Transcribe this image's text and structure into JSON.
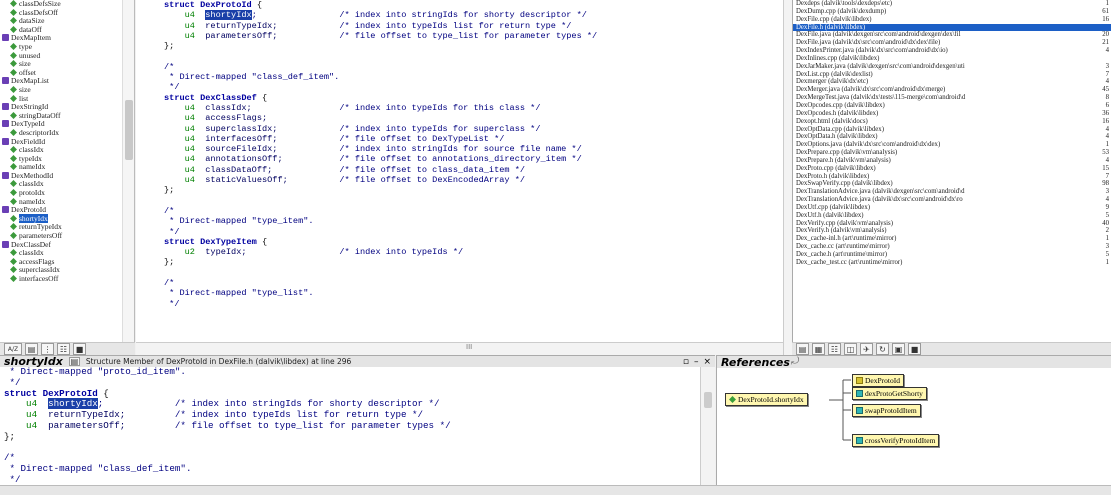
{
  "tree": {
    "items": [
      {
        "label": "classDefsSize",
        "kind": "field",
        "indent": 2
      },
      {
        "label": "classDefsOff",
        "kind": "field",
        "indent": 2
      },
      {
        "label": "dataSize",
        "kind": "field",
        "indent": 2
      },
      {
        "label": "dataOff",
        "kind": "field",
        "indent": 2
      },
      {
        "label": "DexMapItem",
        "kind": "struct",
        "indent": 1
      },
      {
        "label": "type",
        "kind": "field",
        "indent": 2
      },
      {
        "label": "unused",
        "kind": "field",
        "indent": 2
      },
      {
        "label": "size",
        "kind": "field",
        "indent": 2
      },
      {
        "label": "offset",
        "kind": "field",
        "indent": 2
      },
      {
        "label": "DexMapList",
        "kind": "struct",
        "indent": 1
      },
      {
        "label": "size",
        "kind": "field",
        "indent": 2
      },
      {
        "label": "list",
        "kind": "field",
        "indent": 2
      },
      {
        "label": "DexStringId",
        "kind": "struct",
        "indent": 1
      },
      {
        "label": "stringDataOff",
        "kind": "field",
        "indent": 2
      },
      {
        "label": "DexTypeId",
        "kind": "struct",
        "indent": 1
      },
      {
        "label": "descriptorIdx",
        "kind": "field",
        "indent": 2
      },
      {
        "label": "DexFieldId",
        "kind": "struct",
        "indent": 1
      },
      {
        "label": "classIdx",
        "kind": "field",
        "indent": 2
      },
      {
        "label": "typeIdx",
        "kind": "field",
        "indent": 2
      },
      {
        "label": "nameIdx",
        "kind": "field",
        "indent": 2
      },
      {
        "label": "DexMethodId",
        "kind": "struct",
        "indent": 1
      },
      {
        "label": "classIdx",
        "kind": "field",
        "indent": 2
      },
      {
        "label": "protoIdx",
        "kind": "field",
        "indent": 2
      },
      {
        "label": "nameIdx",
        "kind": "field",
        "indent": 2
      },
      {
        "label": "DexProtoId",
        "kind": "struct",
        "indent": 1
      },
      {
        "label": "shortyIdx",
        "kind": "field",
        "indent": 2,
        "selected": true
      },
      {
        "label": "returnTypeIdx",
        "kind": "field",
        "indent": 2
      },
      {
        "label": "parametersOff",
        "kind": "field",
        "indent": 2
      },
      {
        "label": "DexClassDef",
        "kind": "struct",
        "indent": 1
      },
      {
        "label": "classIdx",
        "kind": "field",
        "indent": 2
      },
      {
        "label": "accessFlags",
        "kind": "field",
        "indent": 2
      },
      {
        "label": "superclassIdx",
        "kind": "field",
        "indent": 2
      },
      {
        "label": "interfacesOff",
        "kind": "field",
        "indent": 2
      }
    ],
    "toolbar_sort_label": "A/Z"
  },
  "editor": {
    "lines": [
      [
        {
          "t": "struct ",
          "c": "kw"
        },
        {
          "t": "DexProtoId",
          "c": "kw"
        },
        {
          "t": " {"
        }
      ],
      [
        {
          "t": "    u4  ",
          "c": "ty"
        },
        {
          "t": "shortyIdx",
          "c": "hl"
        },
        {
          "t": ";                /* index into stringIds for shorty descriptor */",
          "c": "cm"
        }
      ],
      [
        {
          "t": "    u4  ",
          "c": "ty"
        },
        {
          "t": "returnTypeIdx;            ",
          "c": "id"
        },
        {
          "t": "/* index into typeIds list for return type */",
          "c": "cm"
        }
      ],
      [
        {
          "t": "    u4  ",
          "c": "ty"
        },
        {
          "t": "parametersOff;            ",
          "c": "id"
        },
        {
          "t": "/* file offset to type_list for parameter types */",
          "c": "cm"
        }
      ],
      [
        {
          "t": "};"
        }
      ],
      [
        {
          "t": ""
        }
      ],
      [
        {
          "t": "/*",
          "c": "cm"
        }
      ],
      [
        {
          "t": " * Direct-mapped \"class_def_item\".",
          "c": "cm"
        }
      ],
      [
        {
          "t": " */",
          "c": "cm"
        }
      ],
      [
        {
          "t": "struct ",
          "c": "kw"
        },
        {
          "t": "DexClassDef",
          "c": "kw"
        },
        {
          "t": " {"
        }
      ],
      [
        {
          "t": "    u4  ",
          "c": "ty"
        },
        {
          "t": "classIdx;                 ",
          "c": "id"
        },
        {
          "t": "/* index into typeIds for this class */",
          "c": "cm"
        }
      ],
      [
        {
          "t": "    u4  ",
          "c": "ty"
        },
        {
          "t": "accessFlags;",
          "c": "id"
        }
      ],
      [
        {
          "t": "    u4  ",
          "c": "ty"
        },
        {
          "t": "superclassIdx;            ",
          "c": "id"
        },
        {
          "t": "/* index into typeIds for superclass */",
          "c": "cm"
        }
      ],
      [
        {
          "t": "    u4  ",
          "c": "ty"
        },
        {
          "t": "interfacesOff;            ",
          "c": "id"
        },
        {
          "t": "/* file offset to DexTypeList */",
          "c": "cm"
        }
      ],
      [
        {
          "t": "    u4  ",
          "c": "ty"
        },
        {
          "t": "sourceFileIdx;            ",
          "c": "id"
        },
        {
          "t": "/* index into stringIds for source file name */",
          "c": "cm"
        }
      ],
      [
        {
          "t": "    u4  ",
          "c": "ty"
        },
        {
          "t": "annotationsOff;           ",
          "c": "id"
        },
        {
          "t": "/* file offset to annotations_directory_item */",
          "c": "cm"
        }
      ],
      [
        {
          "t": "    u4  ",
          "c": "ty"
        },
        {
          "t": "classDataOff;             ",
          "c": "id"
        },
        {
          "t": "/* file offset to class_data_item */",
          "c": "cm"
        }
      ],
      [
        {
          "t": "    u4  ",
          "c": "ty"
        },
        {
          "t": "staticValuesOff;          ",
          "c": "id"
        },
        {
          "t": "/* file offset to DexEncodedArray */",
          "c": "cm"
        }
      ],
      [
        {
          "t": "};"
        }
      ],
      [
        {
          "t": ""
        }
      ],
      [
        {
          "t": "/*",
          "c": "cm"
        }
      ],
      [
        {
          "t": " * Direct-mapped \"type_item\".",
          "c": "cm"
        }
      ],
      [
        {
          "t": " */",
          "c": "cm"
        }
      ],
      [
        {
          "t": "struct ",
          "c": "kw"
        },
        {
          "t": "DexTypeItem",
          "c": "kw"
        },
        {
          "t": " {"
        }
      ],
      [
        {
          "t": "    u2  ",
          "c": "ty"
        },
        {
          "t": "typeIdx;                  ",
          "c": "id"
        },
        {
          "t": "/* index into typeIds */",
          "c": "cm"
        }
      ],
      [
        {
          "t": "};"
        }
      ],
      [
        {
          "t": ""
        }
      ],
      [
        {
          "t": "/*",
          "c": "cm"
        }
      ],
      [
        {
          "t": " * Direct-mapped \"type_list\".",
          "c": "cm"
        }
      ],
      [
        {
          "t": " */",
          "c": "cm"
        }
      ]
    ],
    "scroll_mid_label": "III"
  },
  "files": {
    "rows": [
      {
        "name": "Dexdeps (dalvik\\tools\\dexdeps\\etc)",
        "line": "1"
      },
      {
        "name": "DexDump.cpp (dalvik\\dexdump)",
        "line": "61"
      },
      {
        "name": "DexFile.cpp (dalvik\\libdex)",
        "line": "16"
      },
      {
        "name": "DexFile.h (dalvik\\libdex)",
        "line": "",
        "selected": true
      },
      {
        "name": "DexFile.java (dalvik\\dexgen\\src\\com\\android\\dexgen\\dex\\fil",
        "line": "20"
      },
      {
        "name": "DexFile.java (dalvik\\dx\\src\\com\\android\\dx\\dex\\file)",
        "line": "21"
      },
      {
        "name": "DexIndexPrinter.java (dalvik\\dx\\src\\com\\android\\dx\\io)",
        "line": "4"
      },
      {
        "name": "DexInlines.cpp (dalvik\\libdex)",
        "line": ""
      },
      {
        "name": "DexJarMaker.java (dalvik\\dexgen\\src\\com\\android\\dexgen\\uti",
        "line": "3"
      },
      {
        "name": "DexList.cpp (dalvik\\dexlist)",
        "line": "7"
      },
      {
        "name": "Dexmerger (dalvik\\dx\\etc)",
        "line": "4"
      },
      {
        "name": "DexMerger.java (dalvik\\dx\\src\\com\\android\\dx\\merge)",
        "line": "45"
      },
      {
        "name": "DexMergeTest.java (dalvik\\dx\\tests\\115-merge\\com\\android\\d",
        "line": "8"
      },
      {
        "name": "DexOpcodes.cpp (dalvik\\libdex)",
        "line": "6"
      },
      {
        "name": "DexOpcodes.h (dalvik\\libdex)",
        "line": "36"
      },
      {
        "name": "Dexopt.html (dalvik\\docs)",
        "line": "16"
      },
      {
        "name": "DexOptData.cpp (dalvik\\libdex)",
        "line": "4"
      },
      {
        "name": "DexOptData.h (dalvik\\libdex)",
        "line": "4"
      },
      {
        "name": "DexOptions.java (dalvik\\dx\\src\\com\\android\\dx\\dex)",
        "line": "1"
      },
      {
        "name": "DexPrepare.cpp (dalvik\\vm\\analysis)",
        "line": "53"
      },
      {
        "name": "DexPrepare.h (dalvik\\vm\\analysis)",
        "line": "4"
      },
      {
        "name": "DexProto.cpp (dalvik\\libdex)",
        "line": "15"
      },
      {
        "name": "DexProto.h (dalvik\\libdex)",
        "line": "7"
      },
      {
        "name": "DexSwapVerify.cpp (dalvik\\libdex)",
        "line": "98"
      },
      {
        "name": "DexTranslationAdvice.java (dalvik\\dexgen\\src\\com\\android\\d",
        "line": "3"
      },
      {
        "name": "DexTranslationAdvice.java (dalvik\\dx\\src\\com\\android\\dx\\ro",
        "line": "4"
      },
      {
        "name": "DexUtf.cpp (dalvik\\libdex)",
        "line": "9"
      },
      {
        "name": "DexUtf.h (dalvik\\libdex)",
        "line": "5"
      },
      {
        "name": "DexVerify.cpp (dalvik\\vm\\analysis)",
        "line": "40"
      },
      {
        "name": "DexVerify.h (dalvik\\vm\\analysis)",
        "line": "2"
      },
      {
        "name": "Dex_cache-inl.h (art\\runtime\\mirror)",
        "line": "1"
      },
      {
        "name": "Dex_cache.cc (art\\runtime\\mirror)",
        "line": "3"
      },
      {
        "name": "Dex_cache.h (art\\runtime\\mirror)",
        "line": "5"
      },
      {
        "name": "Dex_cache_test.cc (art\\runtime\\mirror)",
        "line": "1"
      }
    ]
  },
  "context": {
    "symbol": "shortyIdx",
    "description": "Structure Member of DexProtoId in DexFile.h (dalvik\\libdex) at line 296",
    "lines": [
      [
        {
          "t": " * Direct-mapped \"proto_id_item\".",
          "c": "cm"
        }
      ],
      [
        {
          "t": " */",
          "c": "cm"
        }
      ],
      [
        {
          "t": "struct ",
          "c": "kw"
        },
        {
          "t": "DexProtoId",
          "c": "kw"
        },
        {
          "t": " {"
        }
      ],
      [
        {
          "t": "    u4  ",
          "c": "ty"
        },
        {
          "t": "shortyIdx",
          "c": "hl"
        },
        {
          "t": ";             /* index into stringIds for shorty descriptor */",
          "c": "cm"
        }
      ],
      [
        {
          "t": "    u4  ",
          "c": "ty"
        },
        {
          "t": "returnTypeIdx;         ",
          "c": "id"
        },
        {
          "t": "/* index into typeIds list for return type */",
          "c": "cm"
        }
      ],
      [
        {
          "t": "    u4  ",
          "c": "ty"
        },
        {
          "t": "parametersOff;         ",
          "c": "id"
        },
        {
          "t": "/* file offset to type_list for parameter types */",
          "c": "cm"
        }
      ],
      [
        {
          "t": "};"
        }
      ],
      [
        {
          "t": ""
        }
      ],
      [
        {
          "t": "/*",
          "c": "cm"
        }
      ],
      [
        {
          "t": " * Direct-mapped \"class_def_item\".",
          "c": "cm"
        }
      ],
      [
        {
          "t": " */",
          "c": "cm"
        }
      ],
      [
        {
          "t": "struct ",
          "c": "kw"
        },
        {
          "t": "DexClassDef",
          "c": "kw"
        },
        {
          "t": " {"
        }
      ],
      [
        {
          "t": "    u4  ",
          "c": "ty"
        },
        {
          "t": "classIdx;             ",
          "c": "id"
        },
        {
          "t": "/* index into typeIds for this class */",
          "c": "cm"
        }
      ]
    ]
  },
  "references": {
    "title": "References",
    "root": "DexProtoId.shortyIdx",
    "targets": [
      "DexProtoId",
      "dexProtoGetShorty",
      "swapProtoIdItem",
      "crossVerifyProtoIdItem"
    ]
  },
  "window_controls": {
    "pin": "▫",
    "minimize": "–",
    "close": "×"
  }
}
